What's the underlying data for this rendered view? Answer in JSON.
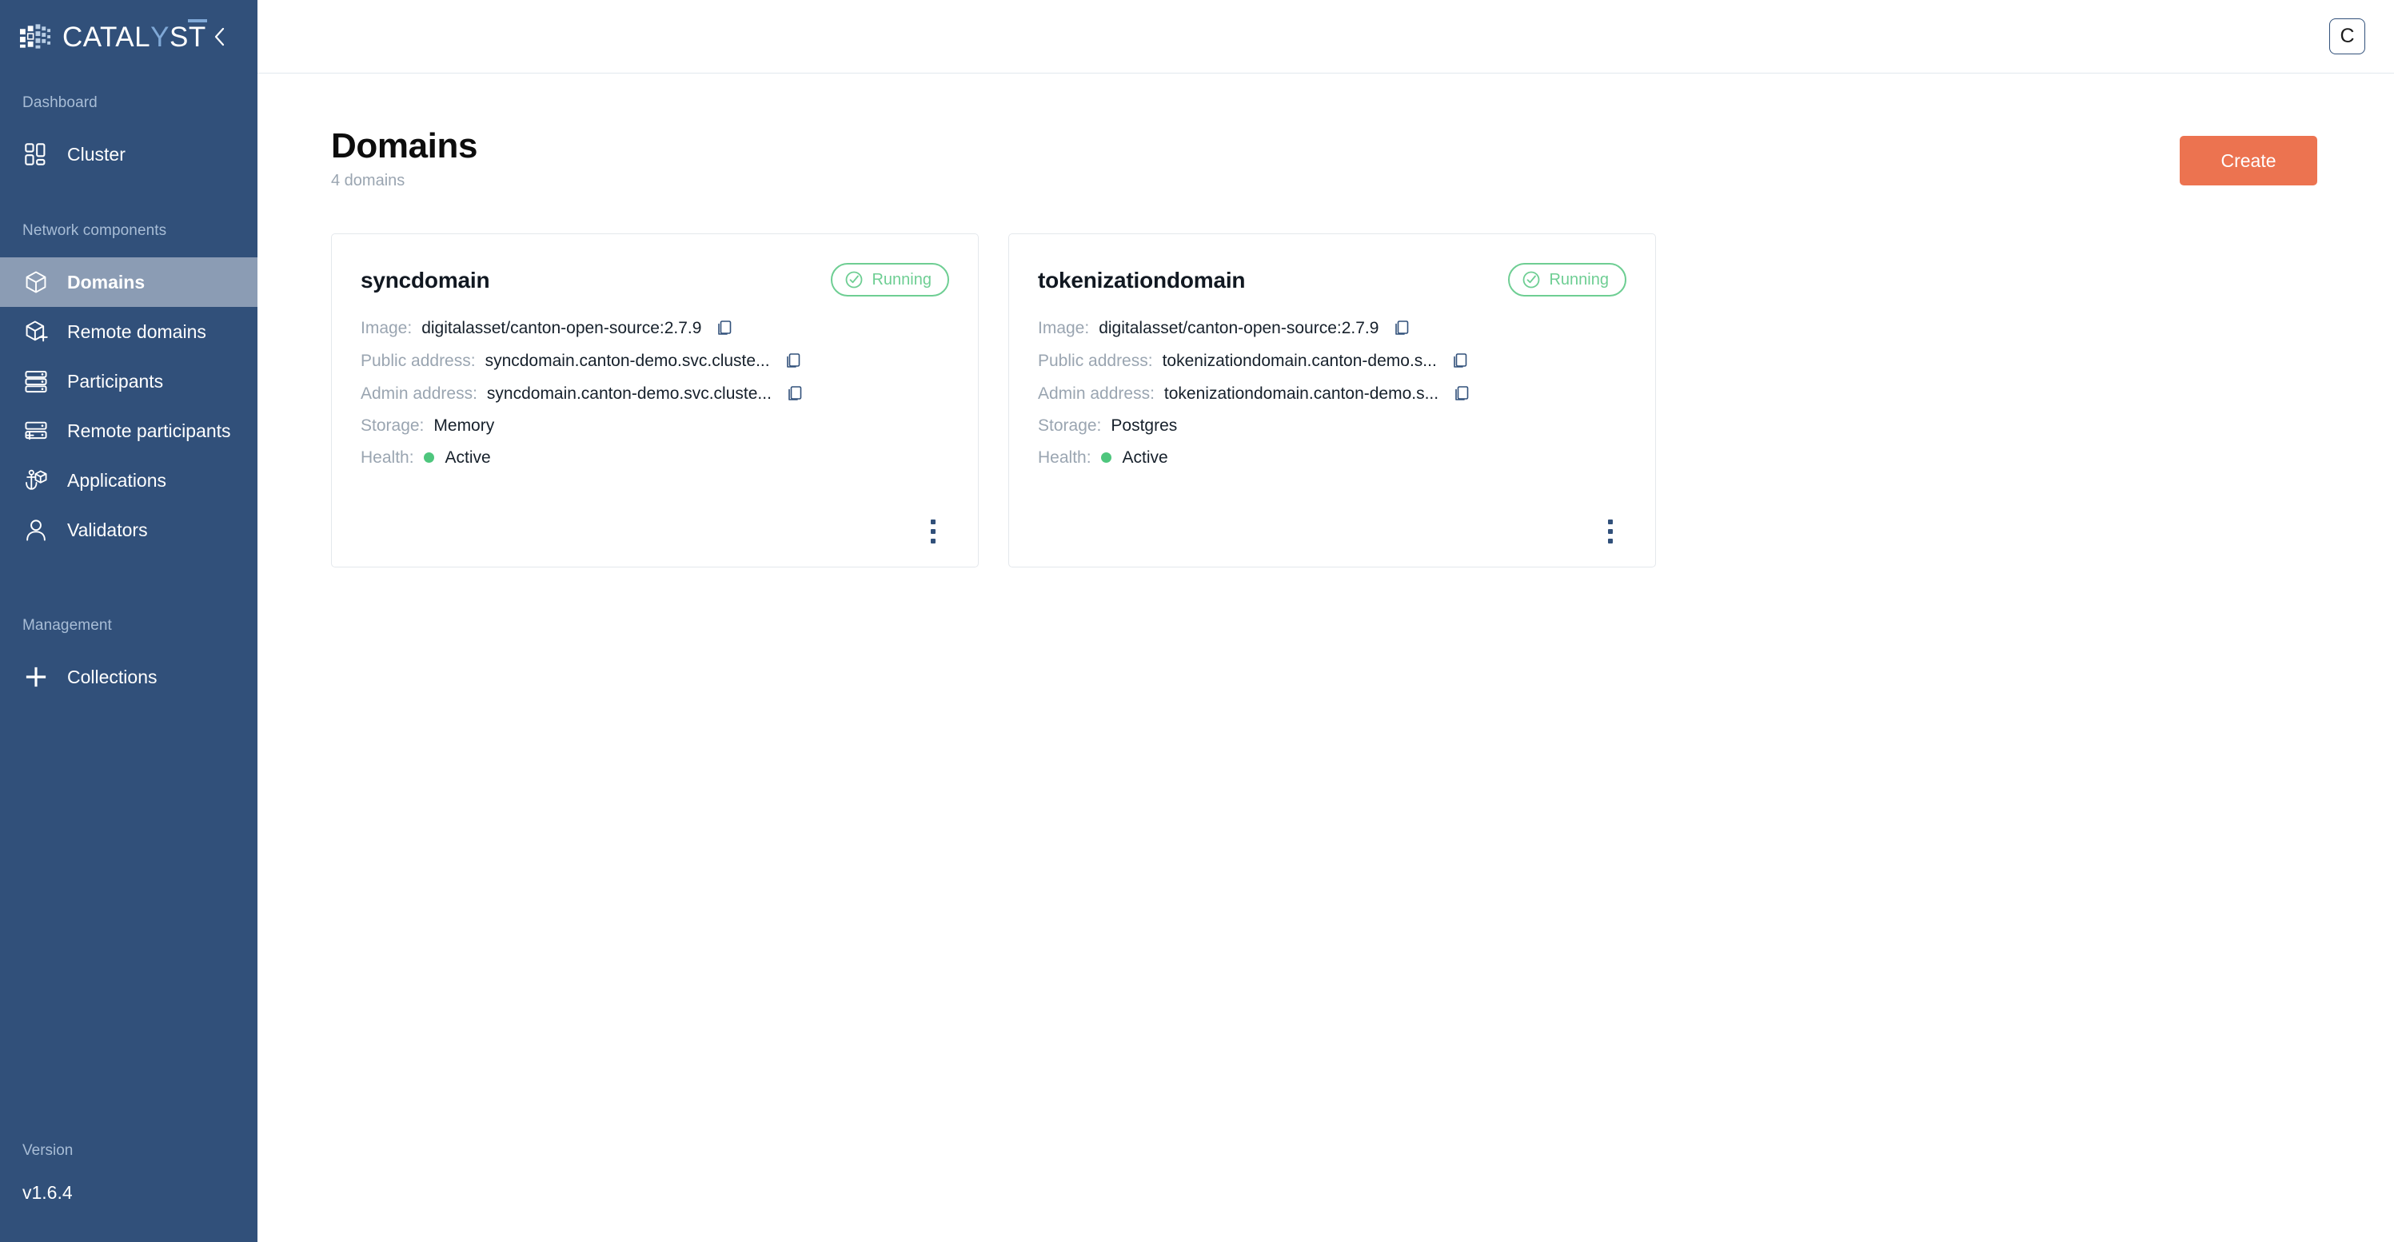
{
  "brand": {
    "name_prefix": "CATAL",
    "name_accent": "Y",
    "name_s": "S",
    "name_t": "T",
    "logo_icon": "cube-grid-icon",
    "collapse_icon": "chevron-left-icon"
  },
  "sidebar": {
    "sections": [
      {
        "label": "Dashboard"
      },
      {
        "label": "Network components"
      },
      {
        "label": "Management"
      }
    ],
    "dashboard_items": [
      {
        "label": "Cluster",
        "icon": "dashboard-grid-icon",
        "active": false
      }
    ],
    "network_items": [
      {
        "label": "Domains",
        "icon": "cube-icon",
        "active": true
      },
      {
        "label": "Remote domains",
        "icon": "cube-plus-icon",
        "active": false
      },
      {
        "label": "Participants",
        "icon": "server-stack-icon",
        "active": false
      },
      {
        "label": "Remote participants",
        "icon": "server-plus-icon",
        "active": false
      },
      {
        "label": "Applications",
        "icon": "docker-anchor-icon",
        "active": false
      },
      {
        "label": "Validators",
        "icon": "user-icon",
        "active": false
      }
    ],
    "management_items": [
      {
        "label": "Collections",
        "icon": "plus-icon",
        "active": false
      }
    ],
    "version_label": "Version",
    "version_value": "v1.6.4"
  },
  "topbar": {
    "avatar_initial": "C"
  },
  "page": {
    "title": "Domains",
    "subtitle": "4 domains",
    "create_label": "Create"
  },
  "labels": {
    "image": "Image:",
    "public_address": "Public address:",
    "admin_address": "Admin address:",
    "storage": "Storage:",
    "health": "Health:",
    "copy_icon": "copy-icon",
    "kebab_icon": "more-vertical-icon",
    "check_icon": "check-circle-icon"
  },
  "colors": {
    "sidebar_bg": "#31507a",
    "sidebar_active_bg": "#8b9cb4",
    "accent": "#ec7350",
    "badge_green": "#6ece93",
    "health_green": "#4ec67d",
    "muted_text": "#9aa5b1"
  },
  "cards": [
    {
      "title": "syncdomain",
      "status": "Running",
      "image": "digitalasset/canton-open-source:2.7.9",
      "public_address": "syncdomain.canton-demo.svc.cluste...",
      "admin_address": "syncdomain.canton-demo.svc.cluste...",
      "storage": "Memory",
      "health": "Active"
    },
    {
      "title": "tokenizationdomain",
      "status": "Running",
      "image": "digitalasset/canton-open-source:2.7.9",
      "public_address": "tokenizationdomain.canton-demo.s...",
      "admin_address": "tokenizationdomain.canton-demo.s...",
      "storage": "Postgres",
      "health": "Active"
    }
  ]
}
